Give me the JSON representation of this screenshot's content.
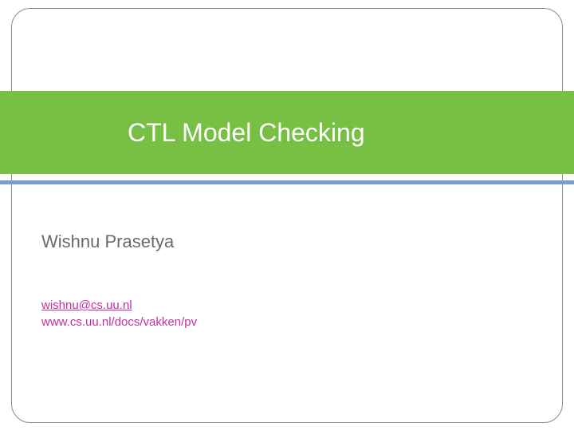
{
  "title": "CTL Model Checking",
  "author": "Wishnu Prasetya",
  "email": "wishnu@cs.uu.nl",
  "website": "www.cs.uu.nl/docs/vakken/pv",
  "colors": {
    "band": "#78c044",
    "accent": "#7a9bcf",
    "link": "#c62fa0",
    "author": "#6a6a6a"
  }
}
